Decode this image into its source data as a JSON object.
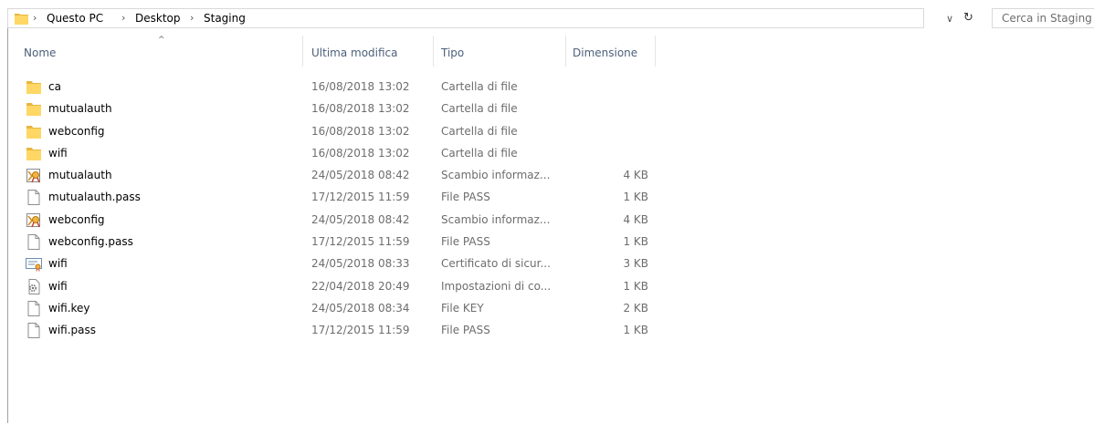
{
  "address": {
    "crumbs": [
      "Questo PC",
      "Desktop",
      "Staging"
    ],
    "separator": "›",
    "dropdown_glyph": "∨",
    "refresh_glyph": "↻"
  },
  "search": {
    "placeholder": "Cerca in Staging"
  },
  "columns": {
    "name": "Nome",
    "modified": "Ultima modifica",
    "type": "Tipo",
    "size": "Dimensione",
    "sort_glyph": "^"
  },
  "files": [
    {
      "name": "ca",
      "modified": "16/08/2018 13:02",
      "type": "Cartella di file",
      "size": "",
      "icon": "folder-icon"
    },
    {
      "name": "mutualauth",
      "modified": "16/08/2018 13:02",
      "type": "Cartella di file",
      "size": "",
      "icon": "folder-icon"
    },
    {
      "name": "webconfig",
      "modified": "16/08/2018 13:02",
      "type": "Cartella di file",
      "size": "",
      "icon": "folder-icon"
    },
    {
      "name": "wifi",
      "modified": "16/08/2018 13:02",
      "type": "Cartella di file",
      "size": "",
      "icon": "folder-icon"
    },
    {
      "name": "mutualauth",
      "modified": "24/05/2018 08:42",
      "type": "Scambio informaz...",
      "size": "4 KB",
      "icon": "pfx-certificate-icon"
    },
    {
      "name": "mutualauth.pass",
      "modified": "17/12/2015 11:59",
      "type": "File PASS",
      "size": "1 KB",
      "icon": "blank-file-icon"
    },
    {
      "name": "webconfig",
      "modified": "24/05/2018 08:42",
      "type": "Scambio informaz...",
      "size": "4 KB",
      "icon": "pfx-certificate-icon"
    },
    {
      "name": "webconfig.pass",
      "modified": "17/12/2015 11:59",
      "type": "File PASS",
      "size": "1 KB",
      "icon": "blank-file-icon"
    },
    {
      "name": "wifi",
      "modified": "24/05/2018 08:33",
      "type": "Certificato di sicur...",
      "size": "3 KB",
      "icon": "security-certificate-icon"
    },
    {
      "name": "wifi",
      "modified": "22/04/2018 20:49",
      "type": "Impostazioni di co...",
      "size": "1 KB",
      "icon": "config-settings-file-icon"
    },
    {
      "name": "wifi.key",
      "modified": "24/05/2018 08:34",
      "type": "File KEY",
      "size": "2 KB",
      "icon": "blank-file-icon"
    },
    {
      "name": "wifi.pass",
      "modified": "17/12/2015 11:59",
      "type": "File PASS",
      "size": "1 KB",
      "icon": "blank-file-icon"
    }
  ],
  "colors": {
    "header_text": "#4c607a",
    "secondary_text": "#6d6d6d",
    "folder_yellow": "#ffd764",
    "folder_dark": "#e8b640"
  }
}
